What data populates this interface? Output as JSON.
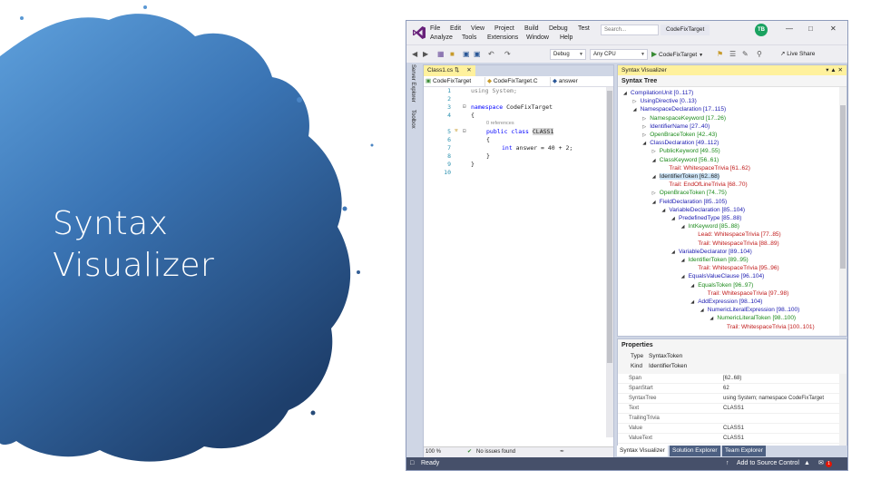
{
  "slide": {
    "title_line1": "Syntax",
    "title_line2": "Visualizer"
  },
  "vs": {
    "menu": [
      "File",
      "Edit",
      "View",
      "Project",
      "Build",
      "Debug",
      "Test",
      "Analyze",
      "Tools",
      "Extensions",
      "Window",
      "Help"
    ],
    "search_placeholder": "Search...",
    "project_title": "CodeFixTarget",
    "avatar_initials": "TB",
    "toolbar": {
      "config": "Debug",
      "platform": "Any CPU",
      "start": "CodeFixTarget",
      "live_share": "Live Share"
    },
    "left_rail": {
      "server_explorer": "Server Explorer",
      "toolbox": "Toolbox"
    },
    "editor": {
      "tab": "Class1.cs",
      "nav_project": "CodeFixTarget",
      "nav_class": "CodeFixTarget.C",
      "nav_member": "answer",
      "line_numbers": [
        "1",
        "2",
        "3",
        "4",
        "5",
        "6",
        "7",
        "8",
        "9",
        "10"
      ],
      "code": {
        "l1": "using System;",
        "l3_kw": "namespace",
        "l3_name": " CodeFixTarget",
        "l4": "{",
        "refs": "0 references",
        "l5_kw": "public class",
        "l5_name": "CLASS1",
        "l6": "{",
        "l7_kw": "int",
        "l7_rest": " answer = 40 + 2;",
        "l8": "}",
        "l9": "}"
      },
      "zoom": "100 %",
      "issues": "No issues found"
    },
    "syntax_visualizer": {
      "title": "Syntax Visualizer",
      "subtitle": "Syntax Tree",
      "nodes": [
        {
          "text": "CompilationUnit [0..117)",
          "color": "blue"
        },
        {
          "text": "UsingDirective [0..13)",
          "color": "blue"
        },
        {
          "text": "NamespaceDeclaration [17..115)",
          "color": "blue"
        },
        {
          "text": "NamespaceKeyword [17..26)",
          "color": "green"
        },
        {
          "text": "IdentifierName [27..40)",
          "color": "blue"
        },
        {
          "text": "OpenBraceToken [42..43)",
          "color": "green"
        },
        {
          "text": "ClassDeclaration [49..112)",
          "color": "blue"
        },
        {
          "text": "PublicKeyword [49..55)",
          "color": "green"
        },
        {
          "text": "ClassKeyword [56..61)",
          "color": "green"
        },
        {
          "text": "Trail: WhitespaceTrivia [61..62)",
          "color": "red"
        },
        {
          "text": "IdentifierToken [62..68)",
          "color": "sel"
        },
        {
          "text": "Trail: EndOfLineTrivia [68..70)",
          "color": "red"
        },
        {
          "text": "OpenBraceToken [74..75)",
          "color": "green"
        },
        {
          "text": "FieldDeclaration [85..105)",
          "color": "blue"
        },
        {
          "text": "VariableDeclaration [85..104)",
          "color": "blue"
        },
        {
          "text": "PredefinedType [85..88)",
          "color": "blue"
        },
        {
          "text": "IntKeyword [85..88)",
          "color": "green"
        },
        {
          "text": "Lead: WhitespaceTrivia [77..85)",
          "color": "red"
        },
        {
          "text": "Trail: WhitespaceTrivia [88..89)",
          "color": "red"
        },
        {
          "text": "VariableDeclarator [89..104)",
          "color": "blue"
        },
        {
          "text": "IdentifierToken [89..95)",
          "color": "green"
        },
        {
          "text": "Trail: WhitespaceTrivia [95..96)",
          "color": "red"
        },
        {
          "text": "EqualsValueClause [96..104)",
          "color": "blue"
        },
        {
          "text": "EqualsToken [96..97)",
          "color": "green"
        },
        {
          "text": "Trail: WhitespaceTrivia [97..98)",
          "color": "red"
        },
        {
          "text": "AddExpression [98..104)",
          "color": "blue"
        },
        {
          "text": "NumericLiteralExpression [98..100)",
          "color": "blue"
        },
        {
          "text": "NumericLiteralToken [98..100)",
          "color": "green"
        },
        {
          "text": "Trail: WhitespaceTrivia [100..101)",
          "color": "red"
        }
      ]
    },
    "properties": {
      "title": "Properties",
      "type_label": "Type",
      "type_value": "SyntaxToken",
      "kind_label": "Kind",
      "kind_value": "IdentifierToken",
      "rows": [
        {
          "k": "Span",
          "v": "[62..68)"
        },
        {
          "k": "SpanStart",
          "v": "62"
        },
        {
          "k": "SyntaxTree",
          "v": "using System; namespace CodeFixTarget"
        },
        {
          "k": "Text",
          "v": "CLASS1"
        },
        {
          "k": "TrailingTrivia",
          "v": ""
        },
        {
          "k": "Value",
          "v": "CLASS1"
        },
        {
          "k": "ValueText",
          "v": "CLASS1"
        }
      ]
    },
    "bottom_tabs": [
      "Syntax Visualizer",
      "Solution Explorer",
      "Team Explorer"
    ],
    "status": {
      "ready": "Ready",
      "source_control": "Add to Source Control",
      "notification_count": "1"
    },
    "colors": {
      "blob_light": "#5a9ad6",
      "blob_dark": "#1f4e86",
      "statusbar": "#46506a",
      "tab_active": "#fff19d",
      "keyword": "#0000ff",
      "tree_blue": "#1a1ab0",
      "tree_green": "#1b8a1b",
      "tree_red": "#c01a1a"
    }
  }
}
